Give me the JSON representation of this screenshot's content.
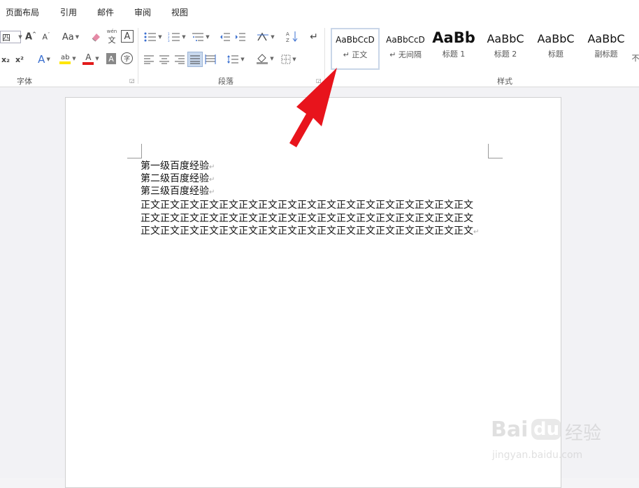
{
  "menu": {
    "items": [
      "页面布局",
      "引用",
      "邮件",
      "审阅",
      "视图"
    ]
  },
  "ribbon": {
    "font_group": {
      "label": "字体",
      "font_size": "四",
      "icons": [
        "font-grow-icon",
        "font-shrink-icon",
        "change-case-icon",
        "clear-format-icon",
        "pinyin-icon",
        "char-border-icon",
        "subscript-icon",
        "superscript-icon",
        "text-effects-icon",
        "highlight-icon",
        "font-color-icon",
        "char-shading-icon",
        "enclose-char-icon"
      ],
      "change_case_label": "Aa",
      "pinyin_top": "wén",
      "pinyin_bottom": "文",
      "char_border_label": "A",
      "subscript_label": "x₂",
      "superscript_label": "x²",
      "effects_label": "A",
      "highlight_label": "ab",
      "color_label": "A",
      "shading_label": "A",
      "enclose_label": "字"
    },
    "paragraph_group": {
      "label": "段落",
      "icons": [
        "bullets-icon",
        "numbering-icon",
        "multilevel-list-icon",
        "decrease-indent-icon",
        "increase-indent-icon",
        "chinese-layout-icon",
        "sort-icon",
        "show-marks-icon",
        "align-left-icon",
        "align-center-icon",
        "align-right-icon",
        "justify-icon",
        "distributed-icon",
        "line-spacing-icon",
        "shading-icon",
        "borders-icon"
      ]
    },
    "styles_group": {
      "label": "样式",
      "styles": [
        {
          "sample": "AaBbCcD",
          "name": "↵ 正文",
          "selected": true
        },
        {
          "sample": "AaBbCcD",
          "name": "↵ 无间隔",
          "selected": false
        },
        {
          "sample": "AaBb",
          "name": "标题 1",
          "selected": false
        },
        {
          "sample": "AaBbC",
          "name": "标题 2",
          "selected": false
        },
        {
          "sample": "AaBbC",
          "name": "标题",
          "selected": false
        },
        {
          "sample": "AaBbC",
          "name": "副标题",
          "selected": false
        }
      ],
      "overflow_name": "不"
    }
  },
  "document": {
    "lines": [
      "第一级百度经验",
      "第二级百度经验",
      "第三级百度经验",
      "正文正文正文正文正文正文正文正文正文正文正文正文正文正文正文正文正文",
      "正文正文正文正文正文正文正文正文正文正文正文正文正文正文正文正文正文",
      "正文正文正文正文正文正文正文正文正文正文正文正文正文正文正文正文正文"
    ],
    "paragraph_mark": "↵"
  },
  "annotation": {
    "arrow_color": "#e8141c"
  },
  "watermark": {
    "brand_latin": "Bai",
    "brand_paw": "du",
    "brand_cn": "经验",
    "url": "jingyan.baidu.com"
  }
}
